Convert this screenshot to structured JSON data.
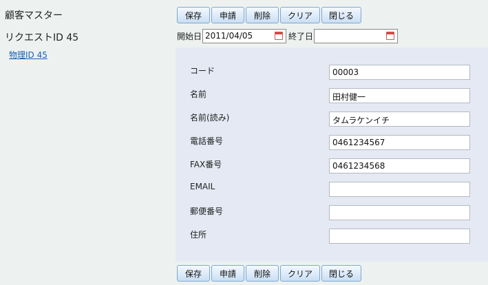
{
  "header": {
    "title": "顧客マスター",
    "request_id": "リクエストID 45",
    "physical_id_link": "物理ID 45"
  },
  "toolbar": {
    "save": "保存",
    "apply": "申請",
    "delete": "削除",
    "clear": "クリア",
    "close": "閉じる"
  },
  "dates": {
    "start_label": "開始日",
    "start_value": "2011/04/05",
    "end_label": "終了日",
    "end_value": ""
  },
  "form": {
    "fields": [
      {
        "label": "コード",
        "value": "00003"
      },
      {
        "label": "名前",
        "value": "田村健一"
      },
      {
        "label": "名前(読み)",
        "value": "タムラケンイチ"
      },
      {
        "label": "電話番号",
        "value": "0461234567"
      },
      {
        "label": "FAX番号",
        "value": "0461234568"
      },
      {
        "label": "EMAIL",
        "value": ""
      },
      {
        "label": "郵便番号",
        "value": ""
      },
      {
        "label": "住所",
        "value": ""
      }
    ]
  },
  "icons": {
    "calendar_icon": "calendar-icon"
  }
}
